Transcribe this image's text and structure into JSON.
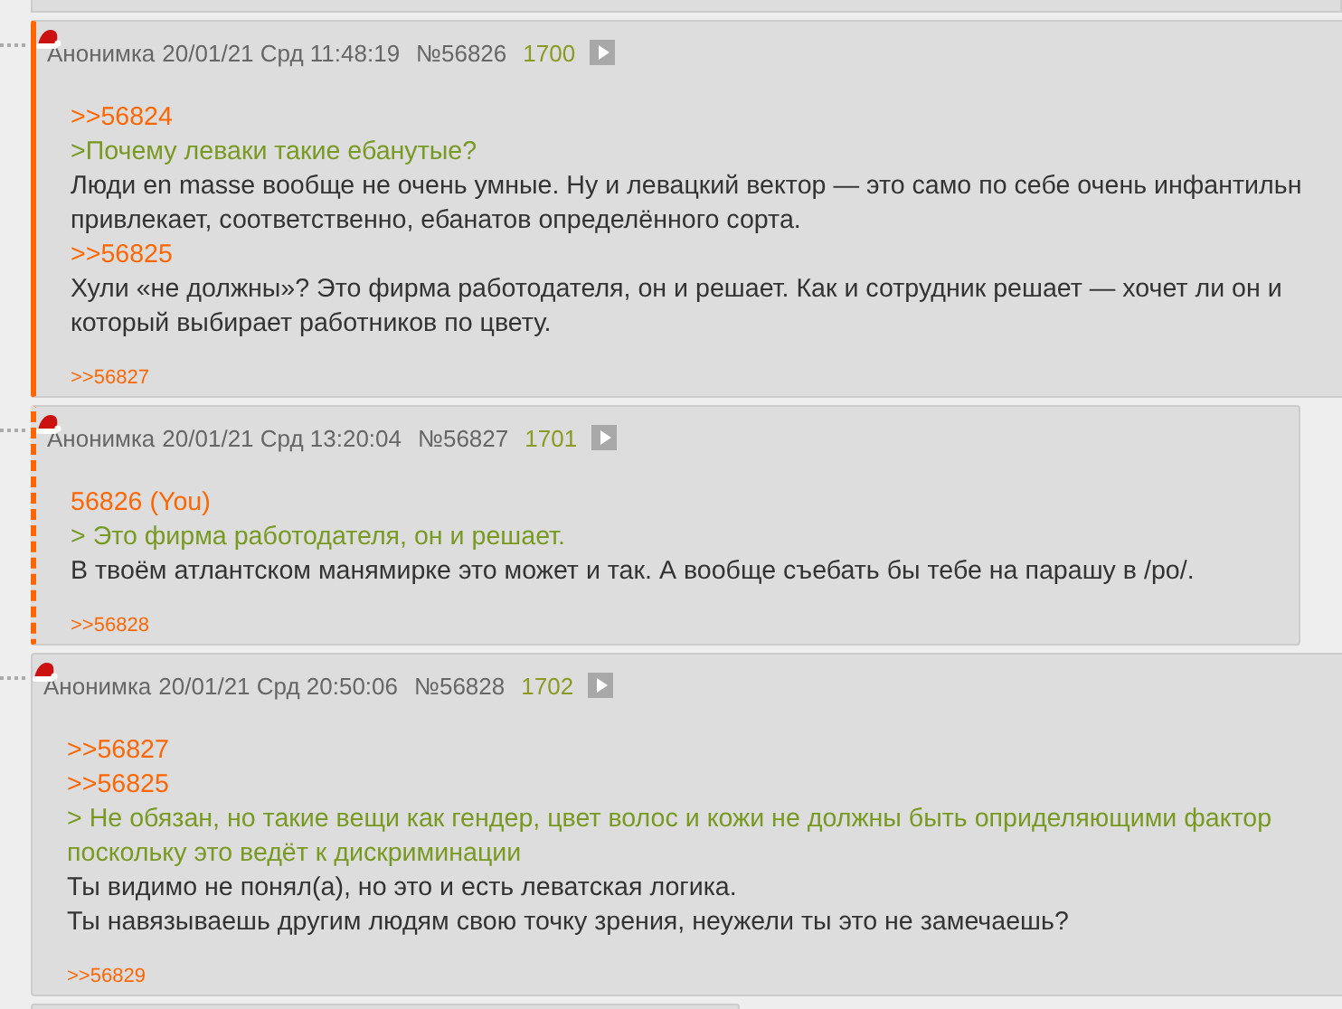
{
  "posts": [
    {
      "kind": "own",
      "name": "Анонимка",
      "date": "20/01/21 Срд 11:48:19",
      "number": "№56826",
      "ordinal": "1700",
      "lines": [
        {
          "kind": "link",
          "text": ">>56824"
        },
        {
          "kind": "quote",
          "text": ">Почему леваки такие ебанутые?"
        },
        {
          "kind": "text",
          "text": "Люди en masse вообще не очень умные. Ну и левацкий вектор — это само по себе очень инфантильн"
        },
        {
          "kind": "text",
          "text": "привлекает, соответственно, ебанатов определённого сорта."
        },
        {
          "kind": "link",
          "text": ">>56825"
        },
        {
          "kind": "text",
          "text": "Хули «не должны»? Это фирма работодателя, он и решает. Как и сотрудник решает — хочет ли он и"
        },
        {
          "kind": "text",
          "text": "который выбирает работников по цвету."
        }
      ],
      "replies": [
        ">>56827"
      ]
    },
    {
      "kind": "reply",
      "name": "Анонимка",
      "date": "20/01/21 Срд 13:20:04",
      "number": "№56827",
      "ordinal": "1701",
      "lines": [
        {
          "kind": "link",
          "text": "56826 (You)"
        },
        {
          "kind": "quote",
          "text": "> Это фирма работодателя, он и решает."
        },
        {
          "kind": "text",
          "text": "В твоём атлантском манямирке это может и так. А вообще съебать бы тебе на парашу в /po/."
        }
      ],
      "replies": [
        ">>56828"
      ]
    },
    {
      "kind": "normal",
      "name": "Анонимка",
      "date": "20/01/21 Срд 20:50:06",
      "number": "№56828",
      "ordinal": "1702",
      "lines": [
        {
          "kind": "link",
          "text": ">>56827"
        },
        {
          "kind": "link",
          "text": ">>56825"
        },
        {
          "kind": "quote",
          "text": "> Не обязан, но такие вещи как гендер, цвет волос и кожи не должны быть оприделяющими фактор"
        },
        {
          "kind": "quote",
          "text": "поскольку это ведёт к дискриминации"
        },
        {
          "kind": "text",
          "text": "Ты видимо не понял(а), но это и есть леватская логика."
        },
        {
          "kind": "text",
          "text": "Ты навязываешь другим людям свою точку зрения, неужели ты это не замечаешь?"
        }
      ],
      "replies": [
        ">>56829"
      ]
    }
  ]
}
